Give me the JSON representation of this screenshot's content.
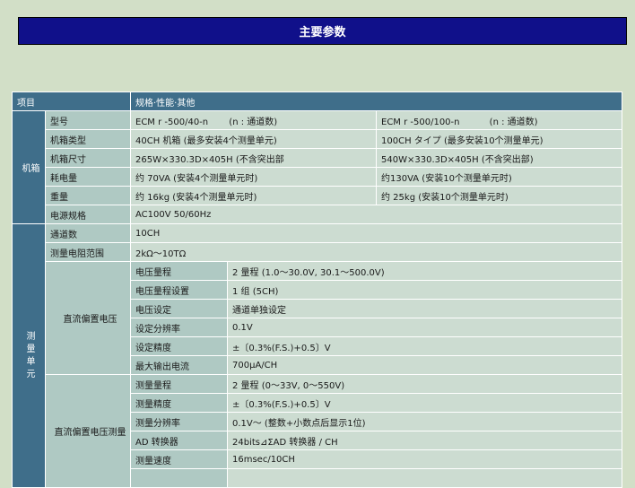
{
  "title": "主要参数",
  "header": {
    "item": "项目",
    "spec": "规格·性能·其他"
  },
  "cabinet": {
    "label": "机箱",
    "rows": [
      {
        "label": "型号",
        "a": "ECM r -500/40-n 　　(n : 通道数)",
        "b": "ECM r -500/100-n 　　　(n : 通道数)"
      },
      {
        "label": "机箱类型",
        "a": "40CH 机箱 (最多安装4个测量单元)",
        "b": "100CH タイプ (最多安装10个测量单元)"
      },
      {
        "label": "机箱尺寸",
        "a": "265W×330.3D×405H (不含突出部",
        "b": "540W×330.3D×405H (不含突出部)"
      },
      {
        "label": "耗电量",
        "a": "约 70VA (安装4个测量单元时)",
        "b": "约130VA (安装10个测量单元时)"
      },
      {
        "label": "重量",
        "a": "约 16kg (安装4个测量单元时)",
        "b": "约 25kg (安装10个测量单元时)"
      },
      {
        "label": "电源规格",
        "value": "AC100V 50/60Hz"
      }
    ]
  },
  "measurement": {
    "label": "测量单元",
    "rows": [
      {
        "label": "通道数",
        "value": "10CH"
      },
      {
        "label": "测量电阻范围",
        "value": "2kΩ～10TΩ"
      }
    ],
    "dc_bias": {
      "label": "直流偏置电压",
      "rows": [
        {
          "label": "电压量程",
          "value": "2 量程 (1.0～30.0V, 30.1～500.0V)"
        },
        {
          "label": "电压量程设置",
          "value": "1 组 (5CH)"
        },
        {
          "label": "电压设定",
          "value": "通道单独设定"
        },
        {
          "label": "设定分辨率",
          "value": "0.1V"
        },
        {
          "label": "设定精度",
          "value": "±〔0.3%(F.S.)+0.5〕V"
        },
        {
          "label": "最大输出电流",
          "value": "700μA/CH"
        }
      ]
    },
    "dc_bias_meas": {
      "label": "直流偏置电压测量",
      "rows": [
        {
          "label": "测量量程",
          "value": "2 量程 (0～33V, 0～550V)"
        },
        {
          "label": "测量精度",
          "value": "±〔0.3%(F.S.)+0.5〕V"
        },
        {
          "label": "测量分辨率",
          "value": "0.1V～ (整数+小数点后显示1位)"
        },
        {
          "label": "AD 转换器",
          "value": "24bits⊿ΣAD 转换器 / CH"
        },
        {
          "label": "测量速度",
          "value": "16msec/10CH"
        }
      ]
    }
  }
}
